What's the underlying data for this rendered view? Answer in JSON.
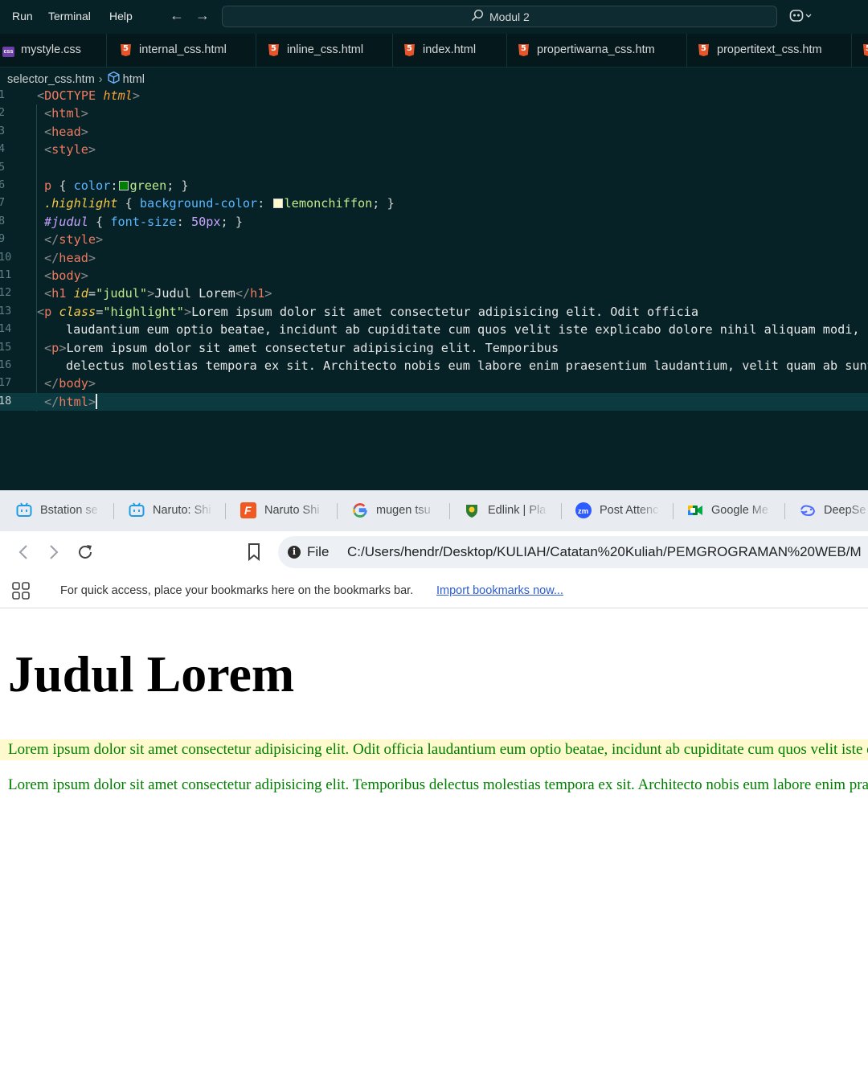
{
  "vscode": {
    "menu": [
      "Run",
      "Terminal",
      "Help"
    ],
    "command_center": "Modul 2",
    "tabs": [
      {
        "label": "mystyle.css",
        "icon": "css-file-icon"
      },
      {
        "label": "internal_css.html",
        "icon": "html5-file-icon"
      },
      {
        "label": "inline_css.html",
        "icon": "html5-file-icon"
      },
      {
        "label": "index.html",
        "icon": "html5-file-icon"
      },
      {
        "label": "propertiwarna_css.htm",
        "icon": "html5-file-icon"
      },
      {
        "label": "propertitext_css.htm",
        "icon": "html5-file-icon"
      }
    ],
    "breadcrumb": {
      "file": "selector_css.htm",
      "symbol": "html"
    },
    "line_numbers": [
      "1",
      "2",
      "3",
      "4",
      "5",
      "6",
      "7",
      "8",
      "9",
      "10",
      "11",
      "12",
      "13",
      "14",
      "15",
      "16",
      "17",
      "18"
    ],
    "active_line": "18",
    "code": {
      "doctype_open": "<!",
      "doctype_kw": "DOCTYPE",
      "doctype_html": "html",
      "tag_html": "html",
      "tag_head": "head",
      "tag_style": "style",
      "css_p_sel": "p",
      "css_p_prop": "color",
      "css_p_val": "green",
      "css_hl_sel": ".highlight",
      "css_hl_prop": "background-color",
      "css_hl_val": "lemonchiffon",
      "css_id_sel": "#judul",
      "css_id_prop": "font-size",
      "css_id_val": "50px",
      "tag_body": "body",
      "tag_h1": "h1",
      "attr_id": "id",
      "attr_id_val": "\"judul\"",
      "h1_text": "Judul Lorem",
      "tag_p": "p",
      "attr_class": "class",
      "attr_class_val": "\"highlight\"",
      "p1_line1": "Lorem ipsum dolor sit amet consectetur adipisicing elit. Odit officia",
      "p1_line2": "laudantium eum optio beatae, incidunt ab cupiditate cum quos velit iste explicabo dolore nihil aliquam modi, p",
      "p2_line1": "Lorem ipsum dolor sit amet consectetur adipisicing elit. Temporibus",
      "p2_line2": "delectus molestias tempora ex sit. Architecto nobis eum labore enim praesentium laudantium, velit quam ab sunt"
    },
    "colors": {
      "background": "#062227",
      "green_swatch": "#008000",
      "lemonchiffon_swatch": "#fffacd"
    }
  },
  "browser": {
    "tabs": [
      {
        "label": "Bstation se",
        "icon": "bilibili-icon"
      },
      {
        "label": "Naruto: Shi",
        "icon": "bilibili-icon"
      },
      {
        "label": "Naruto Shi",
        "icon": "f-logo-icon"
      },
      {
        "label": "mugen tsu",
        "icon": "google-icon"
      },
      {
        "label": "Edlink | Pla",
        "icon": "edlink-icon"
      },
      {
        "label": "Post Attenc",
        "icon": "zoom-icon"
      },
      {
        "label": "Google Me",
        "icon": "google-meet-icon"
      },
      {
        "label": "DeepSe",
        "icon": "deepseek-icon"
      }
    ],
    "omnibox": {
      "scheme": "File",
      "url": "C:/Users/hendr/Desktop/KULIAH/Catatan%20Kuliah/PEMGROGRAMAN%20WEB/M"
    },
    "bookmarks_bar": {
      "text": "For quick access, place your bookmarks here on the bookmarks bar.",
      "link": "Import bookmarks now..."
    },
    "page": {
      "h1": "Judul Lorem",
      "p1": "Lorem ipsum dolor sit amet consectetur adipisicing elit. Odit officia laudantium eum optio beatae, incidunt ab cupiditate cum quos velit iste explicabo",
      "p2": "Lorem ipsum dolor sit amet consectetur adipisicing elit. Temporibus delectus molestias tempora ex sit. Architecto nobis eum labore enim praesentium"
    }
  }
}
